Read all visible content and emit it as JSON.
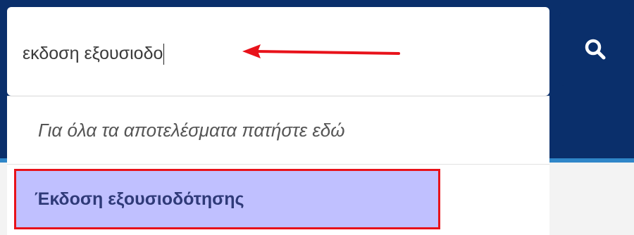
{
  "search": {
    "value": "εκδοση εξουσιοδο",
    "button_icon": "search-icon"
  },
  "dropdown": {
    "all_results_label": "Για όλα τα αποτελέσματα πατήστε εδώ",
    "suggestions": [
      {
        "label": "Έκδοση εξουσιοδότησης",
        "highlighted": true
      }
    ]
  },
  "annotation": {
    "arrow_icon": "red-arrow-icon",
    "color": "#e8121a"
  },
  "colors": {
    "header": "#0a2f6b",
    "accent": "#2f86c8",
    "highlight_fill": "#c0c0ff",
    "highlight_border": "#e8121a"
  }
}
